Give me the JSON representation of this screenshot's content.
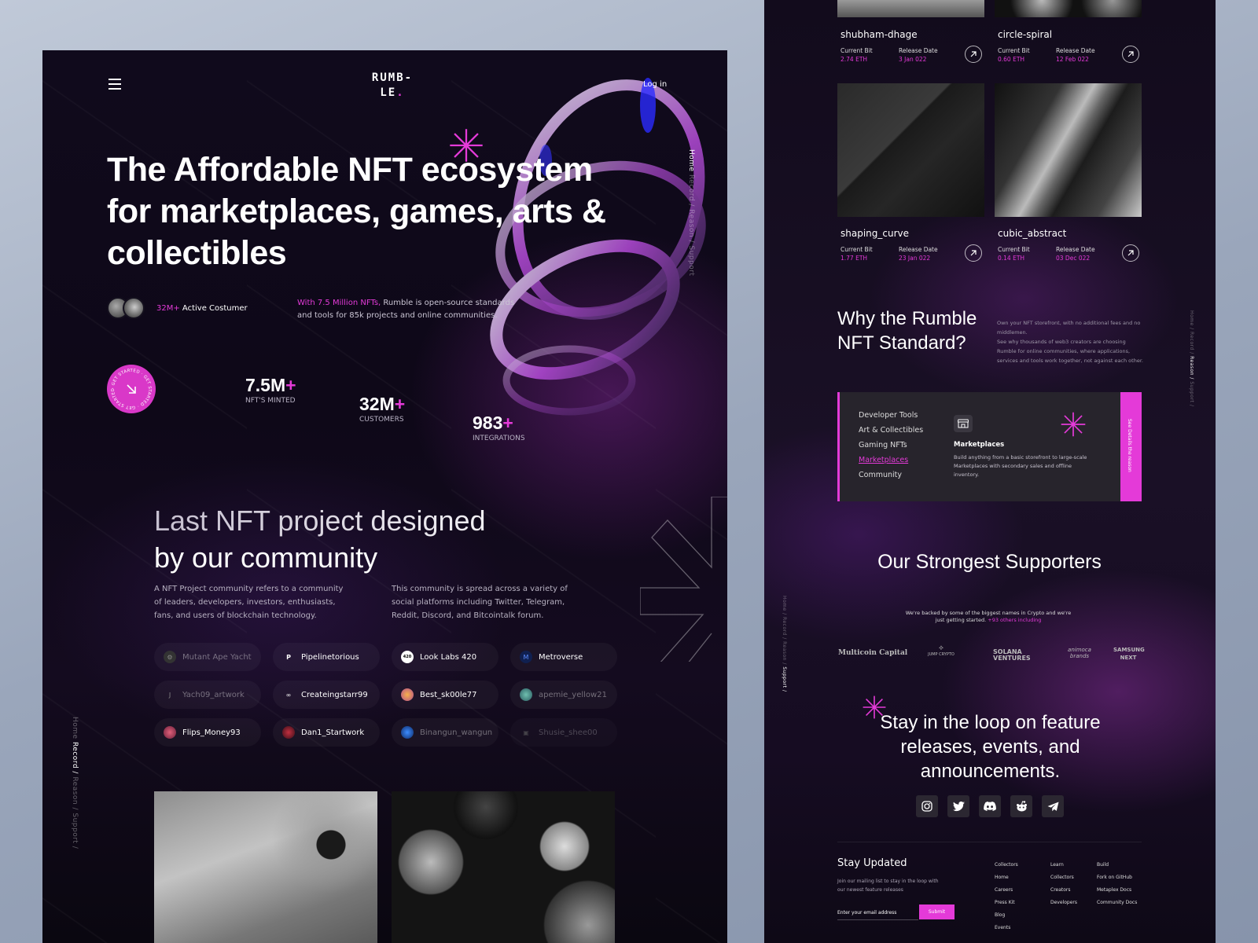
{
  "colors": {
    "accent": "#e43ad8",
    "bg_dark": "#100a1c",
    "panel": "#27242c"
  },
  "left": {
    "nav": {
      "logo_line1": "RUMB-",
      "logo_line2": "LE",
      "logo_dot": ".",
      "login": "Log in",
      "menu_icon": "hamburger-icon"
    },
    "side_nav": {
      "home": "Home",
      "rest": "Record / Reason / Support"
    },
    "side_nav_bottom": {
      "before": "Home ",
      "active": "Record /",
      "after": " Reason / Support /"
    },
    "hero": {
      "title": "The Affordable NFT ecosystem for marketplaces, games, arts & collectibles",
      "active_count": "32M+",
      "active_label": " Active Costumer",
      "desc_highlight": "With 7.5 Million NFTs,",
      "desc_rest": " Rumble is open-source standards and tools for 85k projects and online communities.",
      "cta_ring": "· GET STARTED · GET STARTED · GET STARTED"
    },
    "stats": [
      {
        "value": "7.5M",
        "plus": "+",
        "label": "NFT'S MINTED"
      },
      {
        "value": "32M",
        "plus": "+",
        "label": "CUSTOMERS"
      },
      {
        "value": "983",
        "plus": "+",
        "label": "INTEGRATIONS"
      }
    ],
    "community": {
      "title_line1": "Last NFT project designed",
      "title_line2": "by our community",
      "p1": "A NFT Project community refers to a community of leaders, developers, investors, enthusiasts, fans, and users of blockchain technology.",
      "p2": "This community is spread across a variety of social platforms including Twitter, Telegram, Reddit, Discord, and Bitcointalk forum."
    },
    "chips": [
      {
        "label": "Mutant Ape Yacht",
        "icon": "⚙"
      },
      {
        "label": "Pipelinetorious",
        "icon": "P"
      },
      {
        "label": "Look Labs 420",
        "icon": "420"
      },
      {
        "label": "Metroverse",
        "icon": "M"
      },
      {
        "label": "Yach09_artwork",
        "icon": "J"
      },
      {
        "label": "Createingstarr99",
        "icon": "∞"
      },
      {
        "label": "Best_sk00le77",
        "icon": "●"
      },
      {
        "label": "apemie_yellow21",
        "icon": "●"
      },
      {
        "label": "Flips_Money93",
        "icon": "●"
      },
      {
        "label": "Dan1_Startwork",
        "icon": "●"
      },
      {
        "label": "Binangun_wangun",
        "icon": "●"
      },
      {
        "label": "Shusie_shee00",
        "icon": "▣"
      }
    ]
  },
  "right": {
    "cards": [
      {
        "name": "shubham-dhage",
        "bid_label": "Current Bit",
        "bid": "2.74 ETH",
        "date_label": "Release Date",
        "date": "3 Jan 022"
      },
      {
        "name": "circle-spiral",
        "bid_label": "Current Bit",
        "bid": "0.60 ETH",
        "date_label": "Release Date",
        "date": "12 Feb 022"
      },
      {
        "name": "shaping_curve",
        "bid_label": "Current Bit",
        "bid": "1.77 ETH",
        "date_label": "Release Date",
        "date": "23 Jan 022"
      },
      {
        "name": "cubic_abstract",
        "bid_label": "Current Bit",
        "bid": "0.14 ETH",
        "date_label": "Release Date",
        "date": "03 Dec 022"
      }
    ],
    "why": {
      "title": "Why the Rumble NFT Standard?",
      "d1": "Own your NFT storefront, with no additional fees and no middlemen.",
      "d2": "See why thousands of web3 creators are choosing Rumble for online communities, where applications, services and tools work together, not against each other."
    },
    "tabs": [
      "Developer Tools",
      "Art & Collectibles",
      "Gaming NFTs",
      "Marketplaces",
      "Community"
    ],
    "panel": {
      "title": "Marketplaces",
      "desc": "Build anything from a basic storefront to large-scale Marketplaces with secondary sales and offline inventory.",
      "side": "See Details the reason"
    },
    "side_nav_right": {
      "before": "Home / Record / ",
      "active": "Reason /",
      "after": " Support /"
    },
    "side_nav_left": {
      "before": "Home / Record / Reason / ",
      "active": "Support /"
    },
    "supporters": {
      "title": "Our Strongest Supporters",
      "desc": "We're backed by some of the biggest names in Crypto and we're just getting started.",
      "link": " +93 others including",
      "brands": [
        "Multicoin Capital",
        "JUMP CRYPTO",
        "SOLANA VENTURES",
        "animoca brands",
        "SAMSUNG NEXT"
      ]
    },
    "loop": {
      "title": "Stay in the loop on feature releases, events, and announcements."
    },
    "socials": [
      "instagram-icon",
      "twitter-icon",
      "discord-icon",
      "reddit-icon",
      "telegram-icon"
    ],
    "footer": {
      "title": "Stay Updated",
      "desc": "Join our mailing list to stay in the loop with our newest feature releases",
      "placeholder": "Enter your email address",
      "submit": "Submit",
      "col1": [
        "Collectors",
        "Home",
        "Careers",
        "Press Kit",
        "Blog",
        "Events"
      ],
      "col2": [
        "Learn",
        "Collectors",
        "Creators",
        "Developers"
      ],
      "col3": [
        "Build",
        "Fork on GitHub",
        "Metaplex Docs",
        "Community Docs"
      ]
    }
  }
}
